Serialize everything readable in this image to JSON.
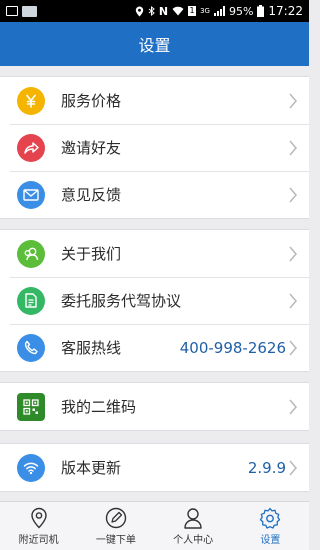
{
  "status_bar": {
    "network": "3G",
    "battery": "95%",
    "time": "17:22"
  },
  "header": {
    "title": "设置"
  },
  "sections": [
    {
      "items": [
        {
          "label": "服务价格",
          "icon": "yuan-icon",
          "color": "#f5b400"
        },
        {
          "label": "邀请好友",
          "icon": "share-icon",
          "color": "#e5434e"
        },
        {
          "label": "意见反馈",
          "icon": "mail-icon",
          "color": "#3a8ee6"
        }
      ]
    },
    {
      "items": [
        {
          "label": "关于我们",
          "icon": "people-icon",
          "color": "#5bbd3a"
        },
        {
          "label": "委托服务代驾协议",
          "icon": "document-icon",
          "color": "#35b866"
        },
        {
          "label": "客服热线",
          "icon": "phone-icon",
          "color": "#3a8ee6",
          "value": "400-998-2626"
        }
      ]
    },
    {
      "items": [
        {
          "label": "我的二维码",
          "icon": "qrcode-icon",
          "color": "#2f8a2a"
        }
      ]
    },
    {
      "items": [
        {
          "label": "版本更新",
          "icon": "wifi-icon",
          "color": "#3a8ee6",
          "value": "2.9.9"
        }
      ]
    }
  ],
  "tabs": [
    {
      "label": "附近司机",
      "icon": "location-pin-icon",
      "active": false
    },
    {
      "label": "一键下单",
      "icon": "pen-order-icon",
      "active": false
    },
    {
      "label": "个人中心",
      "icon": "user-icon",
      "active": false
    },
    {
      "label": "设置",
      "icon": "gear-icon",
      "active": true
    }
  ],
  "colors": {
    "primary": "#1f6fc4",
    "value_text": "#1f5fa8"
  }
}
